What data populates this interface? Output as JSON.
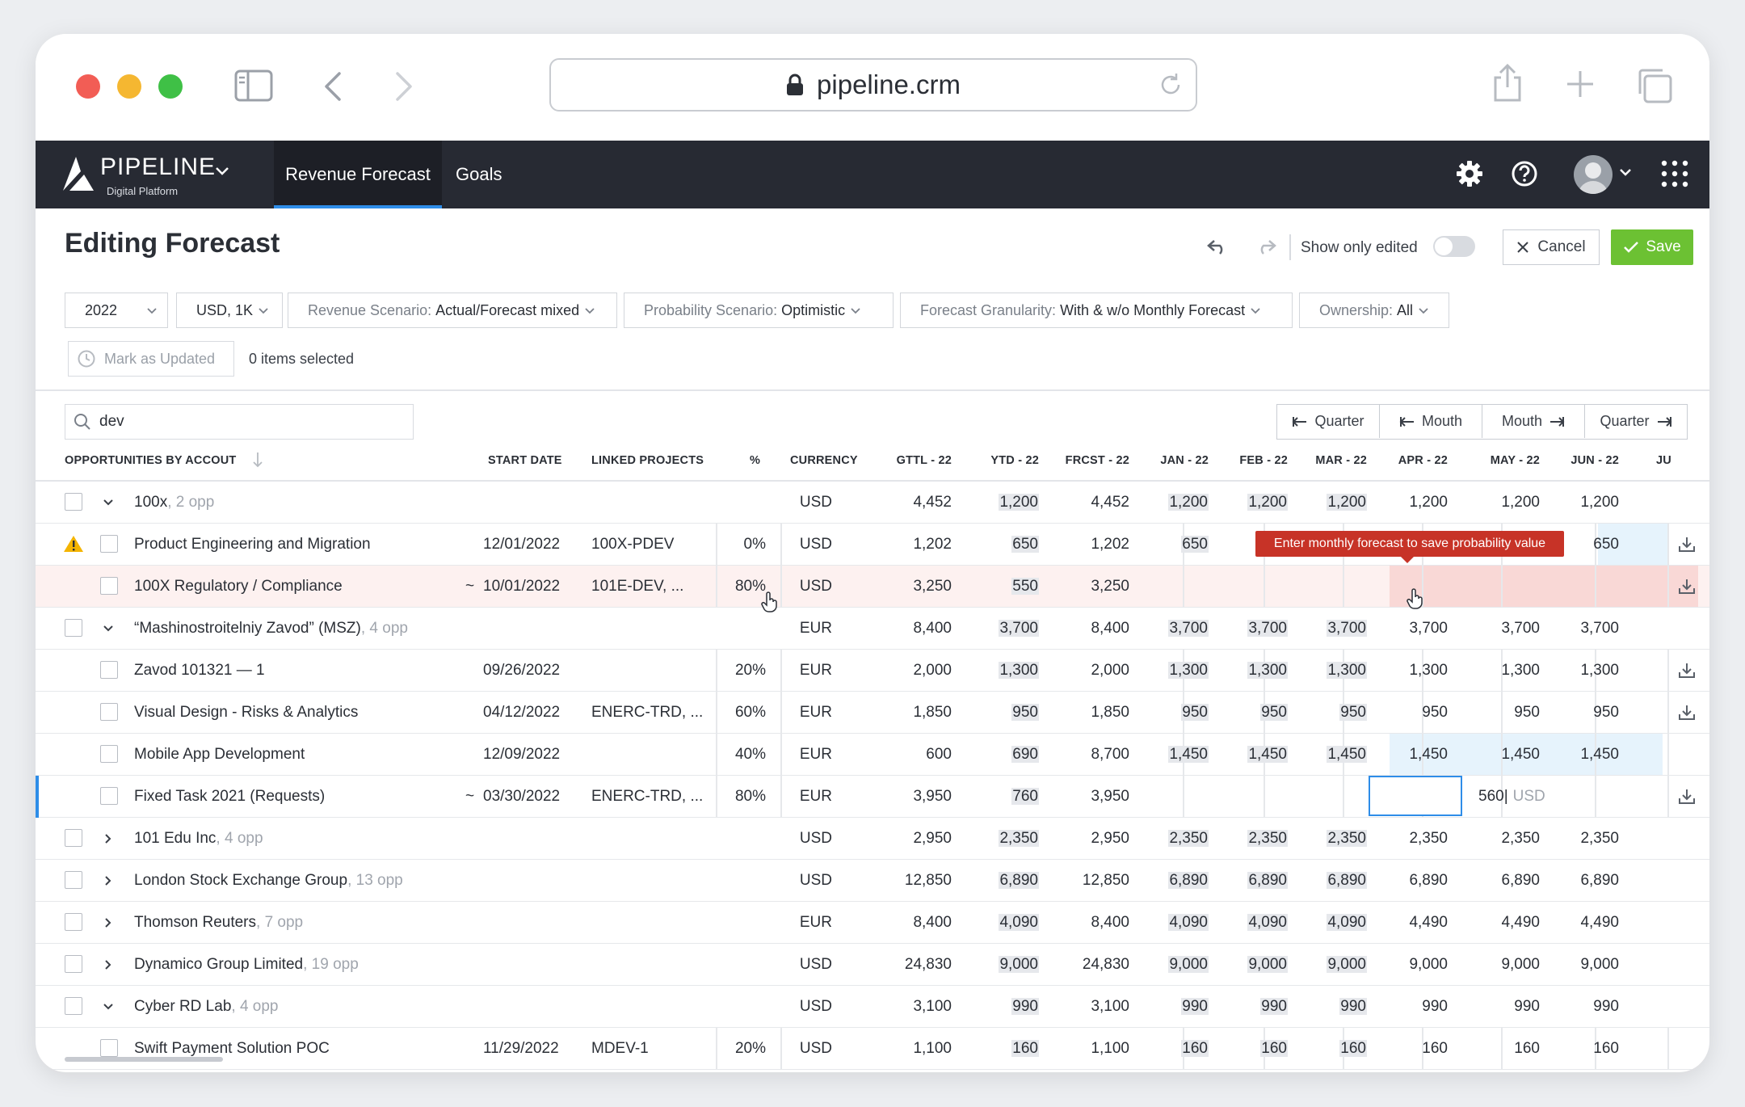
{
  "browser": {
    "url": "pipeline.crm"
  },
  "brand": {
    "name": "PIPELINE",
    "sub": "Digital Platform"
  },
  "nav": {
    "tabs": [
      "Revenue Forecast",
      "Goals"
    ]
  },
  "header": {
    "title": "Editing Forecast",
    "show_only_edited": "Show only edited",
    "cancel": "Cancel",
    "save": "Save"
  },
  "filters": {
    "year": "2022",
    "currency": "USD, 1K",
    "revenue_label": "Revenue Scenario: ",
    "revenue_value": "Actual/Forecast mixed",
    "probability_label": "Probability Scenario: ",
    "probability_value": "Optimistic",
    "granularity_label": "Forecast Granularity: ",
    "granularity_value": "With & w/o Monthly Forecast",
    "ownership_label": "Ownership: ",
    "ownership_value": "All"
  },
  "toolbar": {
    "mark_updated": "Mark as Updated",
    "selected": "0 items selected"
  },
  "search": {
    "value": "dev"
  },
  "period_nav": [
    "Quarter",
    "Mouth",
    "Mouth",
    "Quarter"
  ],
  "columns": {
    "opportunities": "OPPORTUNITIES BY ACCOUT",
    "start_date": "START DATE",
    "linked": "LINKED PROJECTS",
    "pct": "%",
    "currency": "CURRENCY",
    "months": [
      "GTTL - 22",
      "YTD - 22",
      "FRCST - 22",
      "JAN - 22",
      "FEB - 22",
      "MAR - 22",
      "APR - 22",
      "MAY - 22",
      "JUN - 22",
      "JU"
    ]
  },
  "tooltip": "Enter monthly forecast to save probability value",
  "edit_value": "560|",
  "edit_currency": "USD",
  "rows": [
    {
      "name": "100x",
      "count": ", 2 opp",
      "cur": "USD",
      "vals": [
        "4,452",
        "1,200",
        "4,452",
        "1,200",
        "1,200",
        "1,200",
        "1,200",
        "1,200",
        "1,200"
      ]
    },
    {
      "name": "Product Engineering and Migration",
      "date": "12/01/2022",
      "linked": "100X-PDEV",
      "pct": "0%",
      "cur": "USD",
      "vals": [
        "1,202",
        "650",
        "1,202",
        "650",
        "",
        "",
        "",
        "",
        "650"
      ]
    },
    {
      "name": "100X Regulatory / Compliance",
      "tilde": "~",
      "date": "10/01/2022",
      "linked": "101E-DEV, ...",
      "pct": "80%",
      "cur": "USD",
      "vals": [
        "3,250",
        "550",
        "3,250",
        "",
        "",
        "",
        "",
        "",
        ""
      ]
    },
    {
      "name": "“Mashinostroitelniy Zavod” (MSZ)",
      "count": ", 4 opp",
      "cur": "EUR",
      "vals": [
        "8,400",
        "3,700",
        "8,400",
        "3,700",
        "3,700",
        "3,700",
        "3,700",
        "3,700",
        "3,700"
      ]
    },
    {
      "name": "Zavod 101321 — 1",
      "date": "09/26/2022",
      "pct": "20%",
      "cur": "EUR",
      "vals": [
        "2,000",
        "1,300",
        "2,000",
        "1,300",
        "1,300",
        "1,300",
        "1,300",
        "1,300",
        "1,300"
      ]
    },
    {
      "name": "Visual Design - Risks & Analytics",
      "date": "04/12/2022",
      "linked": "ENERC-TRD, ...",
      "pct": "60%",
      "cur": "EUR",
      "vals": [
        "1,850",
        "950",
        "1,850",
        "950",
        "950",
        "950",
        "950",
        "950",
        "950"
      ]
    },
    {
      "name": "Mobile App Development",
      "date": "12/09/2022",
      "pct": "40%",
      "cur": "EUR",
      "vals": [
        "600",
        "690",
        "8,700",
        "1,450",
        "1,450",
        "1,450",
        "1,450",
        "1,450",
        "1,450"
      ]
    },
    {
      "name": "Fixed Task  2021 (Requests)",
      "tilde": "~",
      "date": "03/30/2022",
      "linked": "ENERC-TRD, ...",
      "pct": "80%",
      "cur": "EUR",
      "vals": [
        "3,950",
        "760",
        "3,950",
        "",
        "",
        "",
        "",
        "",
        ""
      ]
    },
    {
      "name": "101 Edu Inc",
      "count": ", 4 opp",
      "cur": "USD",
      "vals": [
        "2,950",
        "2,350",
        "2,950",
        "2,350",
        "2,350",
        "2,350",
        "2,350",
        "2,350",
        "2,350"
      ]
    },
    {
      "name": "London Stock Exchange Group",
      "count": ", 13 opp",
      "cur": "USD",
      "vals": [
        "12,850",
        "6,890",
        "12,850",
        "6,890",
        "6,890",
        "6,890",
        "6,890",
        "6,890",
        "6,890"
      ]
    },
    {
      "name": "Thomson Reuters",
      "count": ", 7 opp",
      "cur": "EUR",
      "vals": [
        "8,400",
        "4,090",
        "8,400",
        "4,090",
        "4,090",
        "4,090",
        "4,490",
        "4,490",
        "4,490"
      ]
    },
    {
      "name": "Dynamico Group Limited",
      "count": ", 19 opp",
      "cur": "USD",
      "vals": [
        "24,830",
        "9,000",
        "24,830",
        "9,000",
        "9,000",
        "9,000",
        "9,000",
        "9,000",
        "9,000"
      ]
    },
    {
      "name": "Cyber RD Lab",
      "count": ", 4 opp",
      "cur": "USD",
      "vals": [
        "3,100",
        "990",
        "3,100",
        "990",
        "990",
        "990",
        "990",
        "990",
        "990"
      ]
    },
    {
      "name": "Swift Payment Solution POC",
      "date": "11/29/2022",
      "linked": "MDEV-1",
      "pct": "20%",
      "cur": "USD",
      "vals": [
        "1,100",
        "160",
        "1,100",
        "160",
        "160",
        "160",
        "160",
        "160",
        "160"
      ]
    }
  ]
}
